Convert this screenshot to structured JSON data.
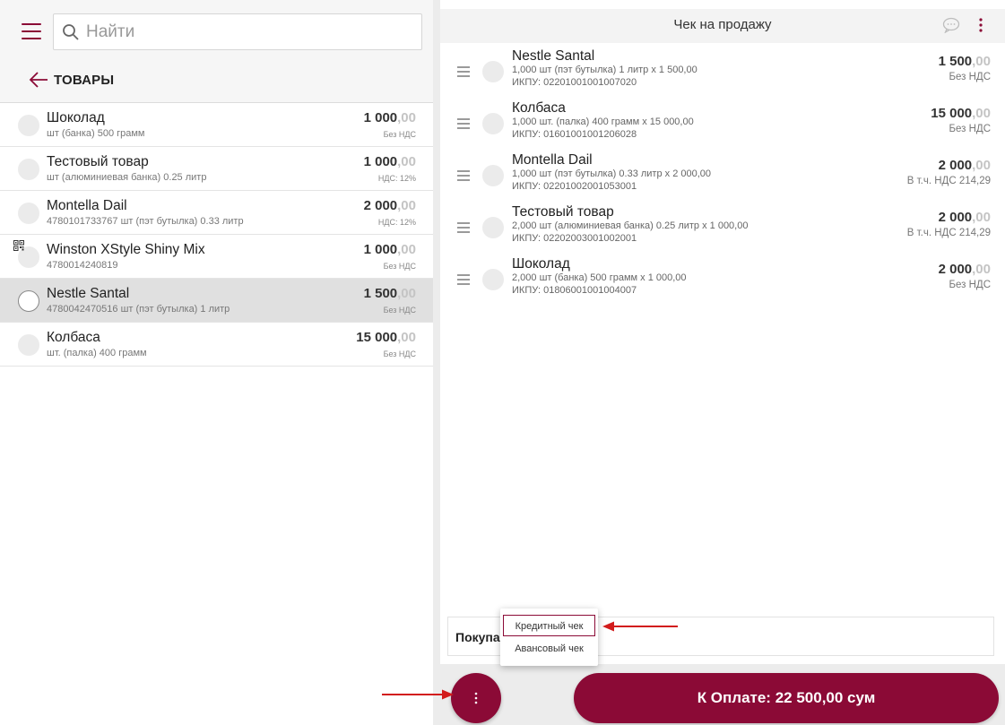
{
  "search": {
    "placeholder": "Найти"
  },
  "nav": {
    "back_label": "ТОВАРЫ"
  },
  "products": [
    {
      "name": "Шоколад",
      "sub": "шт (банка) 500 грамм",
      "price_int": "1 000",
      "price_dec": ",00",
      "tax": "Без НДС"
    },
    {
      "name": "Тестовый товар",
      "sub": "шт (алюминиевая банка) 0.25 литр",
      "price_int": "1 000",
      "price_dec": ",00",
      "tax": "НДС: 12%"
    },
    {
      "name": "Montella Dail",
      "sub": "4780101733767 шт (пэт бутылка) 0.33 литр",
      "price_int": "2 000",
      "price_dec": ",00",
      "tax": "НДС: 12%"
    },
    {
      "name": "Winston XStyle Shiny Mix",
      "sub": "4780014240819",
      "price_int": "1 000",
      "price_dec": ",00",
      "tax": "Без НДС"
    },
    {
      "name": "Nestle Santal",
      "sub": "4780042470516 шт (пэт бутылка) 1 литр",
      "price_int": "1 500",
      "price_dec": ",00",
      "tax": "Без НДС"
    },
    {
      "name": "Колбаса",
      "sub": "шт. (палка) 400 грамм",
      "price_int": "15 000",
      "price_dec": ",00",
      "tax": "Без НДС"
    }
  ],
  "receipt": {
    "title": "Чек на продажу",
    "lines": [
      {
        "name": "Nestle Santal",
        "detail": "1,000 шт (пэт бутылка) 1 литр x 1 500,00",
        "ikpu": "ИКПУ: 02201001001007020",
        "price_int": "1 500",
        "price_dec": ",00",
        "tax": "Без НДС"
      },
      {
        "name": "Колбаса",
        "detail": "1,000 шт. (палка) 400 грамм x 15 000,00",
        "ikpu": "ИКПУ: 01601001001206028",
        "price_int": "15 000",
        "price_dec": ",00",
        "tax": "Без НДС"
      },
      {
        "name": "Montella Dail",
        "detail": "1,000 шт (пэт бутылка) 0.33 литр x 2 000,00",
        "ikpu": "ИКПУ: 02201002001053001",
        "price_int": "2 000",
        "price_dec": ",00",
        "tax": "В т.ч. НДС 214,29"
      },
      {
        "name": "Тестовый товар",
        "detail": "2,000 шт (алюминиевая банка) 0.25 литр x 1 000,00",
        "ikpu": "ИКПУ: 02202003001002001",
        "price_int": "2 000",
        "price_dec": ",00",
        "tax": "В т.ч. НДС 214,29"
      },
      {
        "name": "Шоколад",
        "detail": "2,000 шт (банка) 500 грамм x 1 000,00",
        "ikpu": "ИКПУ: 01806001001004007",
        "price_int": "2 000",
        "price_dec": ",00",
        "tax": "Без НДС"
      }
    ],
    "buyer_label": "Покупа"
  },
  "popup": {
    "items": [
      "Кредитный чек",
      "Авансовый чек"
    ]
  },
  "pay_button": {
    "label": "К Оплате: 22 500,00 сум"
  },
  "colors": {
    "accent": "#8b0a36",
    "arrow": "#d21c1c"
  }
}
